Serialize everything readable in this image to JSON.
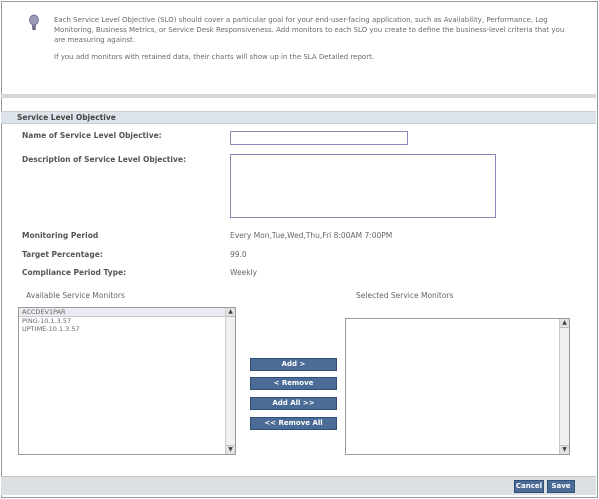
{
  "info": {
    "paragraph1": "Each Service Level Objective (SLO) should cover a particular goal for your end-user-facing application, such as Availability, Performance, Log Monitoring, Business Metrics, or Service Desk Responsiveness. Add monitors to each SLO you create to define the business-level criteria that you are measuring against.",
    "paragraph2": "If you add monitors with retained data, their charts will show up in the SLA Detailed report."
  },
  "section": {
    "title": "Service Level Objective"
  },
  "form": {
    "name_label": "Name of Service Level Objective:",
    "name_value": "",
    "description_label": "Description of Service Level Objective:",
    "description_value": "",
    "monitoring_period_label": "Monitoring Period",
    "monitoring_period_value": "Every Mon,Tue,Wed,Thu,Fri 8:00AM 7:00PM",
    "target_label": "Target Percentage:",
    "target_value": "99.0",
    "compliance_label": "Compliance Period Type:",
    "compliance_value": "Weekly"
  },
  "available": {
    "title": "Available Service Monitors",
    "items": [
      "ACCDEV1PAR",
      "PING-10.1.3.57",
      "UPTIME-10.1.3.57"
    ]
  },
  "selected": {
    "title": "Selected Service Monitors",
    "items": []
  },
  "buttons": {
    "add": "Add >",
    "remove": "< Remove",
    "add_all": "Add All >>",
    "remove_all": "<< Remove All",
    "cancel": "Cancel",
    "save": "Save"
  }
}
